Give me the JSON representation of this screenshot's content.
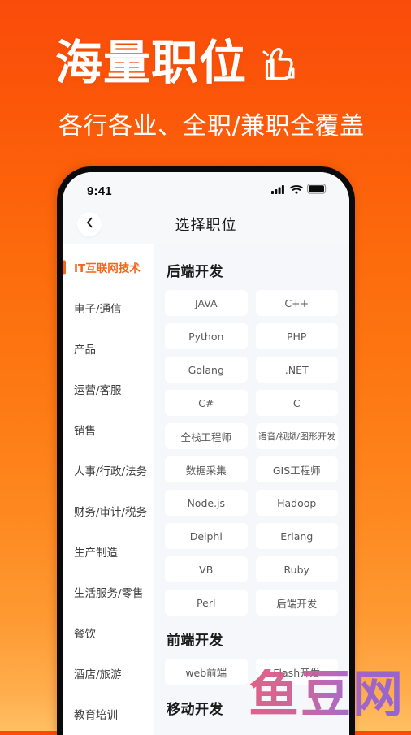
{
  "hero": {
    "title": "海量职位",
    "subtitle": "各行各业、全职/兼职全覆盖",
    "icon": "thumbs-up-icon",
    "bg_top_color": "#FA4B0A",
    "bg_bottom_color": "#FFC062",
    "text_color": "#FFFFFF"
  },
  "phone": {
    "statusbar": {
      "time": "9:41",
      "icons": [
        "cellular-signal-icon",
        "wifi-icon",
        "battery-icon"
      ]
    },
    "navbar": {
      "back_icon": "chevron-left-icon",
      "title": "选择职位"
    },
    "sidebar": {
      "active_index": 0,
      "accent_color": "#F4651A",
      "items": [
        {
          "label": "IT互联网技术"
        },
        {
          "label": "电子/通信"
        },
        {
          "label": "产品"
        },
        {
          "label": "运营/客服"
        },
        {
          "label": "销售"
        },
        {
          "label": "人事/行政/法务"
        },
        {
          "label": "财务/审计/税务"
        },
        {
          "label": "生产制造"
        },
        {
          "label": "生活服务/零售"
        },
        {
          "label": "餐饮"
        },
        {
          "label": "酒店/旅游"
        },
        {
          "label": "教育培训"
        }
      ]
    },
    "panel": {
      "groups": [
        {
          "title": "后端开发",
          "tags": [
            "JAVA",
            "C++",
            "Python",
            "PHP",
            "Golang",
            ".NET",
            "C#",
            "C",
            "全栈工程师",
            "语音/视频/图形开发",
            "数据采集",
            "GIS工程师",
            "Node.js",
            "Hadoop",
            "Delphi",
            "Erlang",
            "VB",
            "Ruby",
            "Perl",
            "后端开发"
          ]
        },
        {
          "title": "前端开发",
          "tags": [
            "web前端",
            "Flash开发"
          ]
        },
        {
          "title": "移动开发",
          "tags": []
        }
      ]
    }
  },
  "watermark": {
    "text": "鱼豆网"
  }
}
